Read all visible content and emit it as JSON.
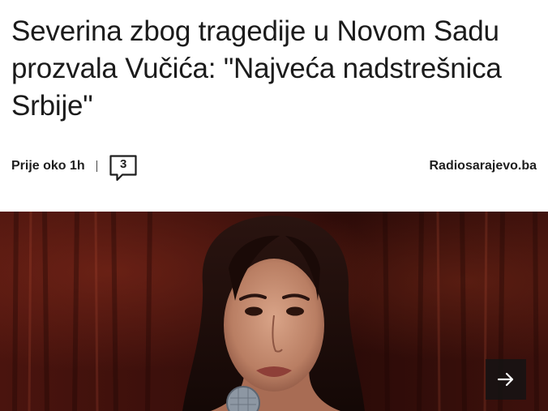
{
  "article": {
    "headline": "Severina zbog tragedije u Novom Sadu prozvala Vučića: \"Najveća nadstrešnica Srbije\"",
    "time": "Prije oko 1h",
    "comment_count": "3",
    "source": "Radiosarajevo.ba"
  },
  "icons": {
    "comment": "comment-bubble-icon",
    "next": "arrow-right-icon"
  },
  "colors": {
    "text": "#1b1b1b",
    "hero_background": "#3a100b",
    "next_button_bg": "#141414"
  }
}
